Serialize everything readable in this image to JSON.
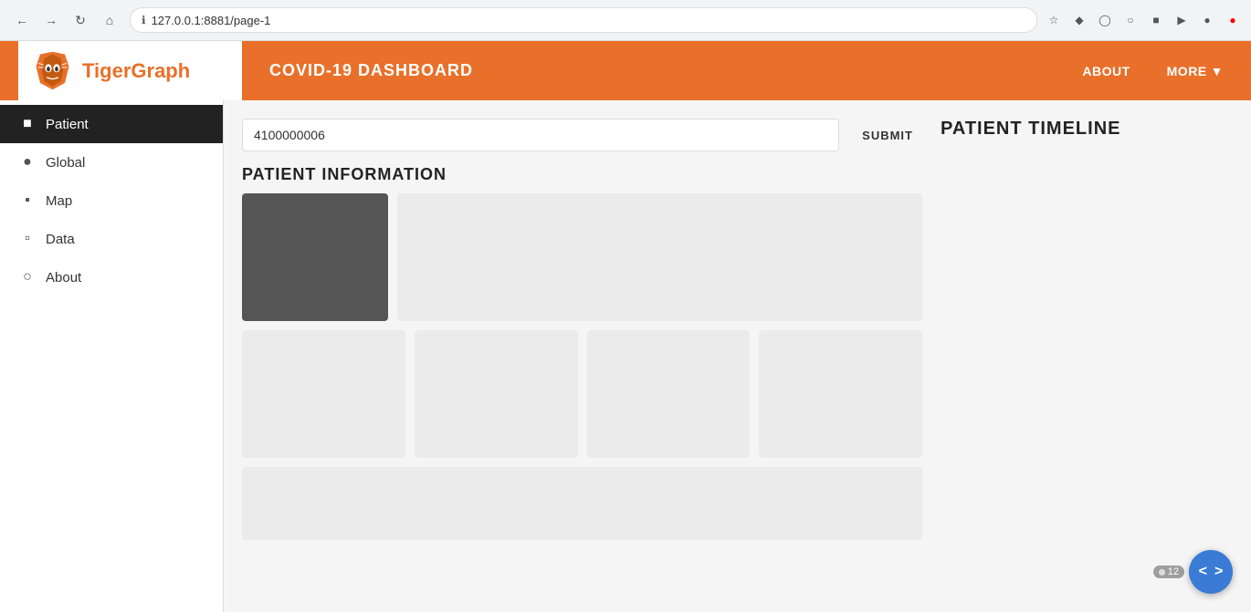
{
  "browser": {
    "url": "127.0.0.1:8881/page-1",
    "back_title": "Back",
    "forward_title": "Forward",
    "refresh_title": "Refresh",
    "home_title": "Home"
  },
  "navbar": {
    "brand": "TigerGraph",
    "title": "COVID-19 DASHBOARD",
    "about_label": "ABOUT",
    "more_label": "MORE"
  },
  "sidebar": {
    "items": [
      {
        "id": "patient",
        "label": "Patient",
        "icon": "👤",
        "active": true
      },
      {
        "id": "global",
        "label": "Global",
        "icon": "🌐",
        "active": false
      },
      {
        "id": "map",
        "label": "Map",
        "icon": "🗺",
        "active": false
      },
      {
        "id": "data",
        "label": "Data",
        "icon": "🗄",
        "active": false
      },
      {
        "id": "about",
        "label": "About",
        "icon": "ℹ",
        "active": false
      }
    ]
  },
  "search": {
    "value": "4100000006",
    "placeholder": "4100000006",
    "submit_label": "SUBMIT"
  },
  "patient_info": {
    "section_title": "PATIENT INFORMATION"
  },
  "timeline": {
    "title": "PATIENT TIMELINE"
  },
  "nav_widget": {
    "count": "12",
    "prev_label": "<",
    "next_label": ">"
  }
}
